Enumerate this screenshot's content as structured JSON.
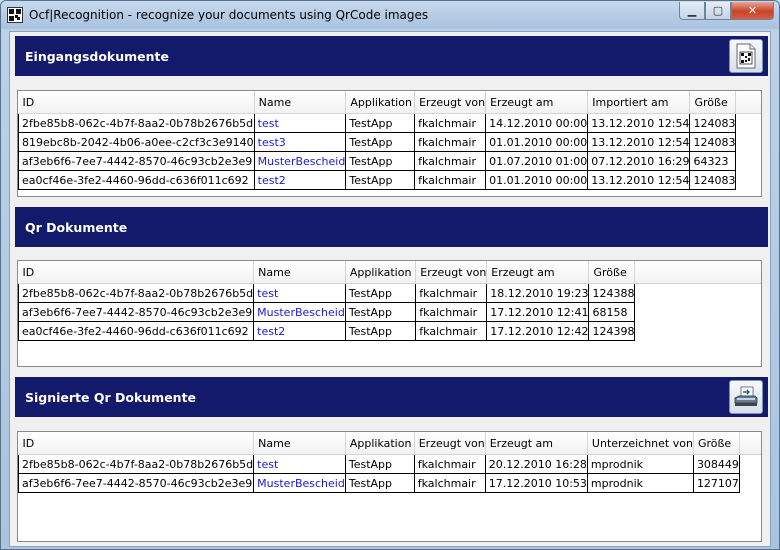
{
  "window": {
    "title": "Ocf|Recognition - recognize your documents using QrCode images",
    "controls": {
      "minimize": "▁",
      "maximize": "▢",
      "close": "✕"
    }
  },
  "sections": {
    "eingang": {
      "title": "Eingangsdokumente",
      "icon": "qr-document-icon",
      "columns": [
        "ID",
        "Name",
        "Applikation",
        "Erzeugt von",
        "Erzeugt am",
        "Importiert am",
        "Größe"
      ],
      "rows": [
        [
          "2fbe85b8-062c-4b7f-8aa2-0b78b2676b5d",
          "test",
          "TestApp",
          "fkalchmair",
          "14.12.2010 00:00",
          "13.12.2010 12:54",
          "124083"
        ],
        [
          "819ebc8b-2042-4b06-a0ee-c2cf3c3e9140",
          "test3",
          "TestApp",
          "fkalchmair",
          "01.01.2010 00:00",
          "13.12.2010 12:54",
          "124083"
        ],
        [
          "af3eb6f6-7ee7-4442-8570-46c93cb2e3e9",
          "MusterBescheid",
          "TestApp",
          "fkalchmair",
          "01.07.2010 01:00",
          "07.12.2010 16:29",
          "64323"
        ],
        [
          "ea0cf46e-3fe2-4460-96dd-c636f011c692",
          "test2",
          "TestApp",
          "fkalchmair",
          "01.01.2010 00:00",
          "13.12.2010 12:54",
          "124083"
        ]
      ]
    },
    "qr": {
      "title": "Qr Dokumente",
      "columns": [
        "ID",
        "Name",
        "Applikation",
        "Erzeugt von",
        "Erzeugt am",
        "Größe"
      ],
      "rows": [
        [
          "2fbe85b8-062c-4b7f-8aa2-0b78b2676b5d",
          "test",
          "TestApp",
          "fkalchmair",
          "18.12.2010 19:23",
          "124388"
        ],
        [
          "af3eb6f6-7ee7-4442-8570-46c93cb2e3e9",
          "MusterBescheid",
          "TestApp",
          "fkalchmair",
          "17.12.2010 12:41",
          "68158"
        ],
        [
          "ea0cf46e-3fe2-4460-96dd-c636f011c692",
          "test2",
          "TestApp",
          "fkalchmair",
          "17.12.2010 12:42",
          "124398"
        ]
      ]
    },
    "signiert": {
      "title": "Signierte Qr Dokumente",
      "icon": "scanner-sign-icon",
      "columns": [
        "ID",
        "Name",
        "Applikation",
        "Erzeugt von",
        "Erzeugt am",
        "Unterzeichnet von",
        "Größe"
      ],
      "rows": [
        [
          "2fbe85b8-062c-4b7f-8aa2-0b78b2676b5d",
          "test",
          "TestApp",
          "fkalchmair",
          "20.12.2010 16:28",
          "mprodnik",
          "308449"
        ],
        [
          "af3eb6f6-7ee7-4442-8570-46c93cb2e3e9",
          "MusterBescheid",
          "TestApp",
          "fkalchmair",
          "17.12.2010 10:53",
          "mprodnik",
          "127107"
        ]
      ]
    }
  }
}
